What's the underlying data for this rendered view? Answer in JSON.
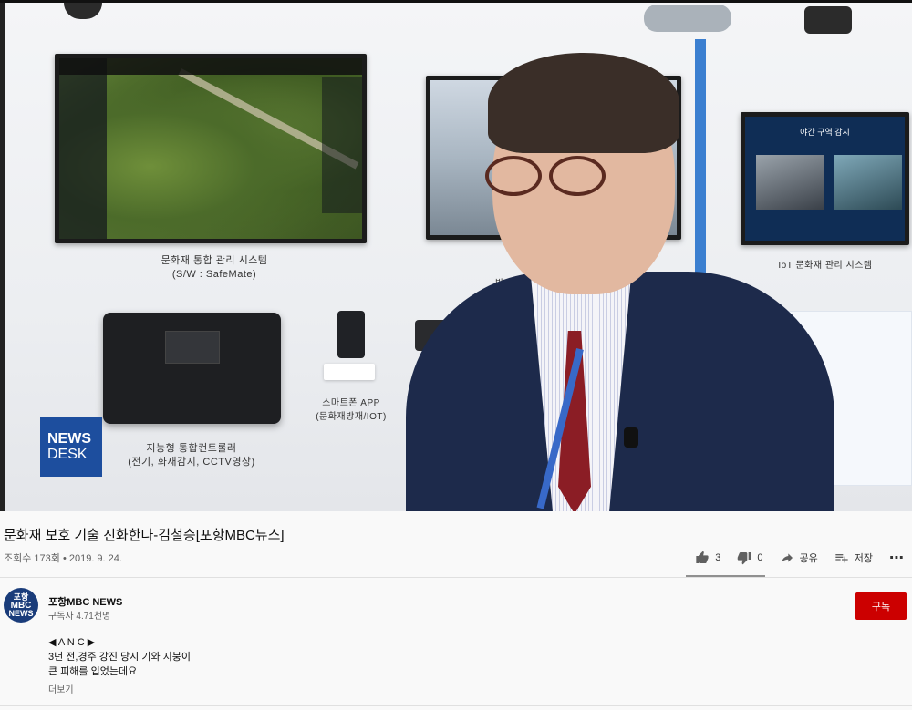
{
  "video": {
    "tv1_caption_line1": "문화재 통합 관리 시스템",
    "tv1_caption_line2": "(S/W : SafeMate)",
    "tv2_caption": "방재시",
    "tv3_title": "야간 구역 감시",
    "tv3_caption": "IoT 문화재 관리 시스템",
    "controller_caption_line1": "지능형 통합컨트롤러",
    "controller_caption_line2": "(전기, 화재감지, CCTV영상)",
    "phone_caption_line1": "스마트폰 APP",
    "phone_caption_line2": "(문화재방재/IOT)",
    "logo_line1": "NEWS",
    "logo_line2": "DESK"
  },
  "info": {
    "title": "문화재 보호 기술 진화한다-김철승[포항MBC뉴스]",
    "meta": "조회수 173회 • 2019. 9. 24.",
    "likes": "3",
    "dislikes": "0",
    "share_label": "공유",
    "save_label": "저장",
    "more_icon": "⋯"
  },
  "channel": {
    "avatar_line1": "포항",
    "avatar_line2": "MBC",
    "avatar_line3": "NEWS",
    "name": "포항MBC NEWS",
    "subscribers": "구독자 4.71천명",
    "subscribe_label": "구독"
  },
  "description": {
    "line1": "◀ A N C ▶",
    "line2": "3년 전,경주 강진 당시 기와 지붕이",
    "line3": "큰 피해를 입었는데요",
    "more_label": "더보기"
  },
  "colors": {
    "subscribe": "#cc0000",
    "news_desk_blue": "#1d4e9e"
  }
}
